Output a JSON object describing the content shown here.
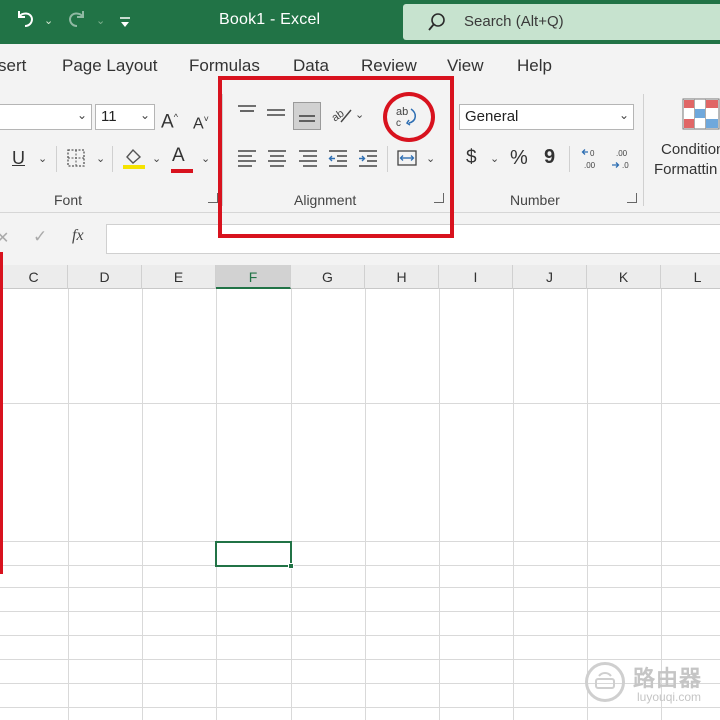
{
  "titlebar": {
    "title": "Book1  -  Excel",
    "search_label": "Search (Alt+Q)",
    "undo_icon": "undo-icon",
    "redo_icon": "redo-icon",
    "customize_icon": "customize-quick-access-icon",
    "colors": {
      "bar": "#217346",
      "search_bg": "#c7e3cf"
    }
  },
  "tabs": [
    {
      "label": "sert"
    },
    {
      "label": "Page Layout"
    },
    {
      "label": "Formulas"
    },
    {
      "label": "Data"
    },
    {
      "label": "Review"
    },
    {
      "label": "View"
    },
    {
      "label": "Help"
    }
  ],
  "ribbon": {
    "font": {
      "font_size": "11",
      "grow_label": "A",
      "shrink_label": "A",
      "underline_label": "U",
      "font_color_label": "A",
      "group_label": "Font"
    },
    "alignment": {
      "group_label": "Alignment",
      "icons": [
        "top-align-icon",
        "middle-align-icon",
        "bottom-align-icon",
        "orientation-icon",
        "wrap-text-icon",
        "align-left-icon",
        "center-icon",
        "align-right-icon",
        "decrease-indent-icon",
        "increase-indent-icon",
        "merge-center-icon"
      ]
    },
    "number": {
      "format": "General",
      "currency_label": "$",
      "percent_label": "%",
      "comma_label": "9",
      "group_label": "Number"
    },
    "styles": {
      "conditional_line1": "Condition",
      "conditional_line2": "Formattin"
    }
  },
  "formula_bar": {
    "cancel_label": "✕",
    "enter_label": "✓",
    "fx_label": "fx",
    "value": ""
  },
  "grid": {
    "columns": [
      "C",
      "D",
      "E",
      "F",
      "G",
      "H",
      "I",
      "J",
      "K",
      "L"
    ],
    "active_column": "F"
  },
  "annotations": {
    "color": "#d8121e"
  },
  "watermark": {
    "cn": "路由器",
    "en": "luyouqi.com"
  }
}
